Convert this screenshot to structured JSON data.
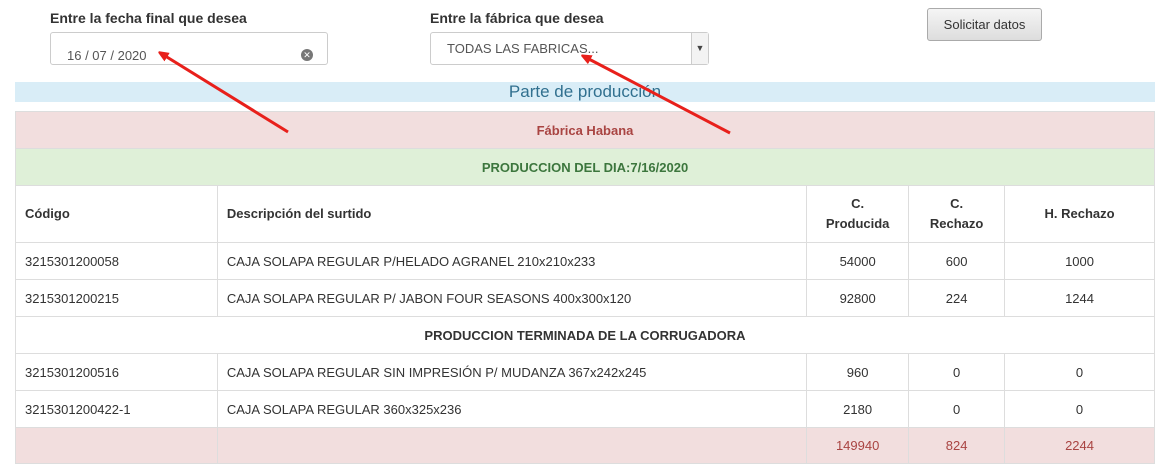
{
  "filters": {
    "date_label": "Entre la fecha final que desea",
    "date_value": "16 / 07 / 2020",
    "factory_label": "Entre la fábrica que desea",
    "factory_value": "TODAS LAS FABRICAS...",
    "submit_label": "Solicitar datos"
  },
  "report": {
    "title": "Parte de producción",
    "factory_name": "Fábrica Habana",
    "day_header": "PRODUCCION DEL DIA:7/16/2020",
    "columns": {
      "code": "Código",
      "description": "Descripción del surtido",
      "produced_line1": "C.",
      "produced_line2": "Producida",
      "rejected_line1": "C.",
      "rejected_line2": "Rechazo",
      "h_rejected": "H. Rechazo"
    },
    "rows": [
      {
        "code": "3215301200058",
        "description": "CAJA SOLAPA REGULAR P/HELADO AGRANEL 210x210x233",
        "produced": "54000",
        "rejected": "600",
        "h_rejected": "1000"
      },
      {
        "code": "3215301200215",
        "description": "CAJA SOLAPA REGULAR P/ JABON FOUR SEASONS 400x300x120",
        "produced": "92800",
        "rejected": "224",
        "h_rejected": "1244"
      }
    ],
    "section_header": "PRODUCCION TERMINADA DE LA CORRUGADORA",
    "section_rows": [
      {
        "code": "3215301200516",
        "description": "CAJA SOLAPA REGULAR SIN IMPRESIÓN P/ MUDANZA 367x242x245",
        "produced": "960",
        "rejected": "0",
        "h_rejected": "0"
      },
      {
        "code": "3215301200422-1",
        "description": "CAJA SOLAPA REGULAR 360x325x236",
        "produced": "2180",
        "rejected": "0",
        "h_rejected": "0"
      }
    ],
    "totals": {
      "produced": "149940",
      "rejected": "824",
      "h_rejected": "2244"
    }
  },
  "colors": {
    "title_band": "#d9edf7",
    "factory_row": "#f2dede",
    "day_row": "#dff0d8",
    "annotation_arrow": "#e8201b"
  },
  "icons": {
    "date_clear": "clear-circle-icon",
    "select_toggle": "chevron-down-icon",
    "annotation": "red-arrow-icon"
  }
}
